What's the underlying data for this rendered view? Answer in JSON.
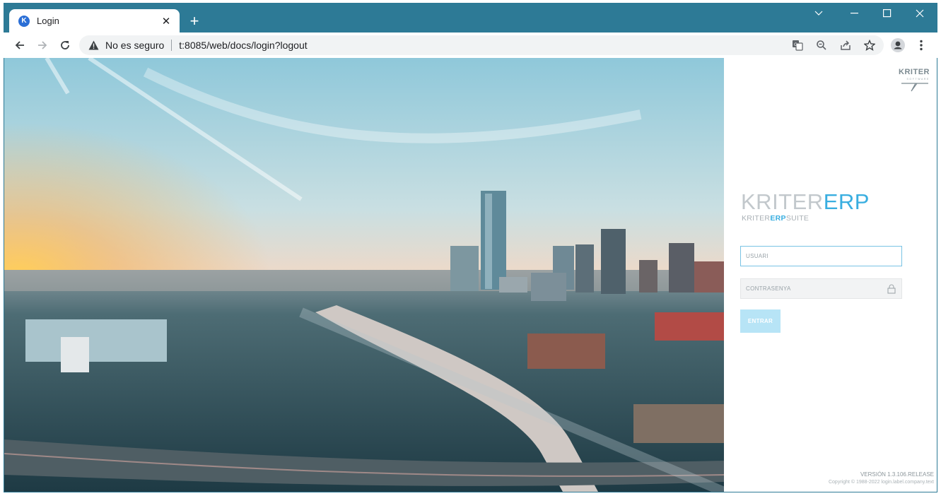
{
  "browser": {
    "tab": {
      "favicon_letter": "K",
      "title": "Login",
      "close_glyph": "✕"
    },
    "new_tab_glyph": "+",
    "security_label": "No es seguro",
    "url": "t:8085/web/docs/login?logout",
    "colors": {
      "frame": "#2d7a96",
      "favicon": "#2b6fd6"
    }
  },
  "login": {
    "logo": {
      "text": "KRITER",
      "subtext": "SOFTWARE"
    },
    "product_name_part1": "KRITER",
    "product_name_part2": "ERP",
    "suite_part1": "KRITER",
    "suite_part2": "ERP",
    "suite_part3": "SUITE",
    "username_placeholder": "USUARI",
    "password_placeholder": "CONTRASENYA",
    "submit_label": "ENTRAR",
    "version": "VERSIÓN 1.3.106.RELEASE",
    "copyright": "Copyright © 1988-2022 login.label.company.text",
    "colors": {
      "accent": "#39aee0",
      "button": "#b7e4f6"
    }
  }
}
